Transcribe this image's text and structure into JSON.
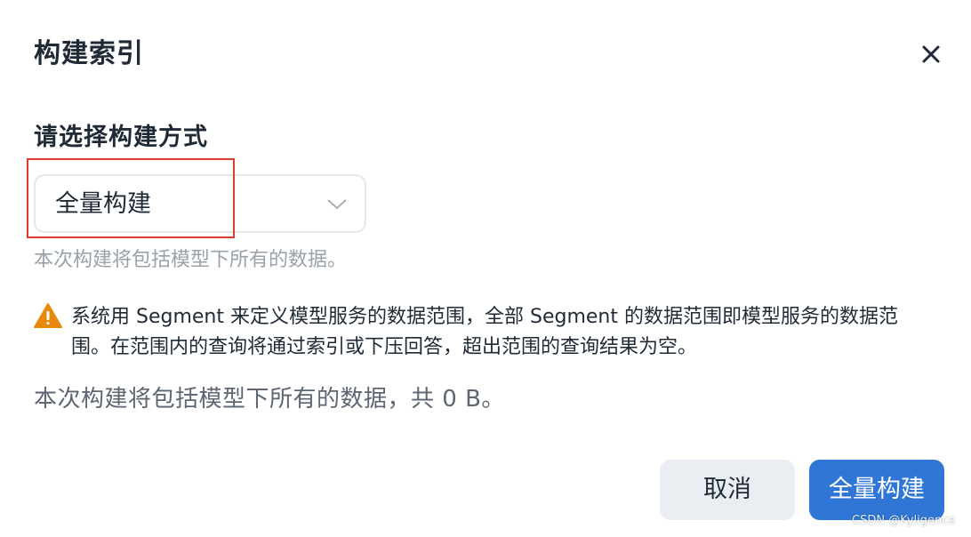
{
  "dialog": {
    "title": "构建索引",
    "close_icon": "close-icon"
  },
  "build_method": {
    "label": "请选择构建方式",
    "selected": "全量构建",
    "hint": "本次构建将包括模型下所有的数据。"
  },
  "warning": {
    "icon": "warning-triangle-icon",
    "icon_color": "#e8890c",
    "text": "系统用 Segment 来定义模型服务的数据范围，全部 Segment 的数据范围即模型服务的数据范围。在范围内的查询将通过索引或下压回答，超出范围的查询结果为空。"
  },
  "summary": "本次构建将包括模型下所有的数据，共 0 B。",
  "footer": {
    "cancel_label": "取消",
    "confirm_label": "全量构建"
  },
  "colors": {
    "primary": "#2f76d6",
    "highlight": "#e03b2f",
    "text": "#1f2a36",
    "muted": "#99a1ab"
  },
  "watermark": "CSDN @Kyligence"
}
